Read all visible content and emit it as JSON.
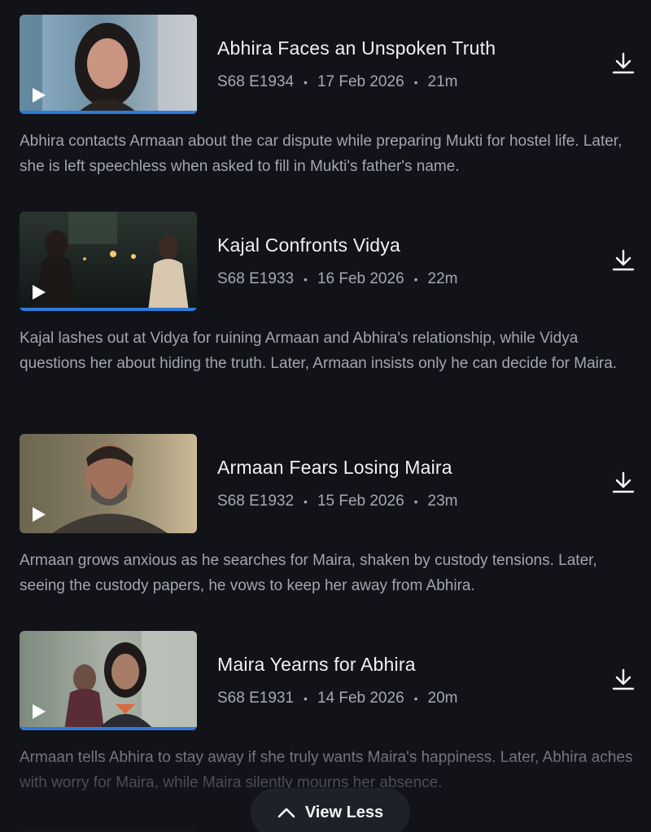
{
  "episodes": [
    {
      "title": "Abhira Faces an Unspoken Truth",
      "code": "S68 E1934",
      "date": "17 Feb 2026",
      "duration": "21m",
      "description": "Abhira contacts Armaan about the car dispute while preparing Mukti for hostel life. Later, she is left speechless when asked to fill in Mukti's father's name.",
      "watched_fraction": 1.0
    },
    {
      "title": "Kajal Confronts Vidya",
      "code": "S68 E1933",
      "date": "16 Feb 2026",
      "duration": "22m",
      "description": "Kajal lashes out at Vidya for ruining Armaan and Abhira's relationship, while Vidya questions her about hiding the truth. Later, Armaan insists only he can decide for Maira.",
      "watched_fraction": 1.0
    },
    {
      "title": "Armaan Fears Losing Maira",
      "code": "S68 E1932",
      "date": "15 Feb 2026",
      "duration": "23m",
      "description": "Armaan grows anxious as he searches for Maira, shaken by custody tensions. Later, seeing the custody papers, he vows to keep her away from Abhira.",
      "watched_fraction": 0
    },
    {
      "title": "Maira Yearns for Abhira",
      "code": "S68 E1931",
      "date": "14 Feb 2026",
      "duration": "20m",
      "description": "Armaan tells Abhira to stay away if she truly wants Maira's happiness. Later, Abhira aches with worry for Maira, while Maira silently mourns her absence.",
      "watched_fraction": 1.0
    }
  ],
  "meta_separator": "•",
  "view_less_label": "View Less",
  "colors": {
    "background": "#121319",
    "progress": "#2f7ad8",
    "title": "#f0f1f5",
    "meta": "#a5a8b4",
    "button_bg": "#1f2128"
  },
  "icons": {
    "download": "download-icon",
    "play": "play-icon",
    "view_less": "chevron-up-icon"
  }
}
